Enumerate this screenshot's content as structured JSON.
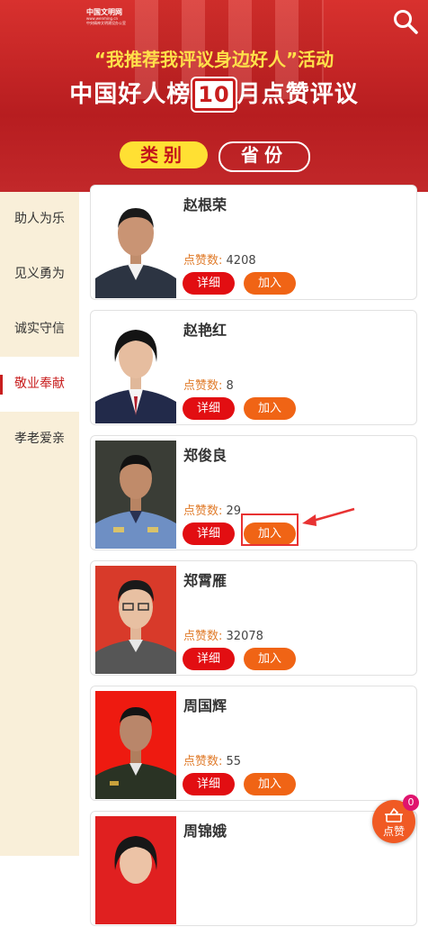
{
  "header": {
    "logo_title": "中国文明网",
    "logo_line2": "www.wenming.cn",
    "logo_line3": "中央精神文明建设办公室",
    "subtitle": "“我推荐我评议身边好人”活动",
    "title_prefix": "中国好人榜",
    "title_number": "10",
    "title_suffix": "月点赞评议",
    "tab_category": "类别",
    "tab_province": "省份",
    "search_icon": "search-icon"
  },
  "sidebar": {
    "items": [
      {
        "label": "助人为乐",
        "active": false
      },
      {
        "label": "见义勇为",
        "active": false
      },
      {
        "label": "诚实守信",
        "active": false
      },
      {
        "label": "敬业奉献",
        "active": true
      },
      {
        "label": "孝老爱亲",
        "active": false
      }
    ]
  },
  "list": {
    "likes_label": "点赞数:",
    "detail_label": "详细",
    "join_label": "加入",
    "cards": [
      {
        "name": "赵根荣",
        "likes": "4208"
      },
      {
        "name": "赵艳红",
        "likes": "8"
      },
      {
        "name": "郑俊良",
        "likes": "29"
      },
      {
        "name": "郑霄雁",
        "likes": "32078"
      },
      {
        "name": "周国辉",
        "likes": "55"
      },
      {
        "name": "周锦娥",
        "likes": ""
      }
    ]
  },
  "vote_button": {
    "label": "点赞",
    "count": "0"
  },
  "colors": {
    "brand_red": "#c81e1e",
    "accent_orange": "#f06415",
    "detail_red": "#e20e12",
    "gold": "#ffe033"
  }
}
